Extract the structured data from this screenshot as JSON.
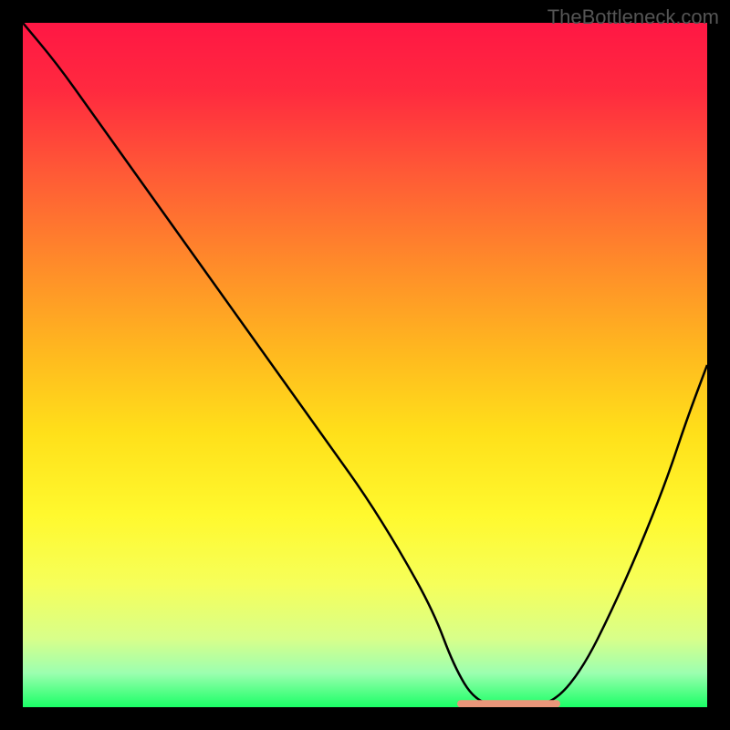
{
  "watermark": "TheBottleneck.com",
  "chart_data": {
    "type": "line",
    "title": "",
    "xlabel": "",
    "ylabel": "",
    "xlim": [
      0,
      100
    ],
    "ylim": [
      0,
      100
    ],
    "gradient_stops": [
      {
        "offset": 0,
        "color": "#ff1744"
      },
      {
        "offset": 10,
        "color": "#ff2a3f"
      },
      {
        "offset": 22,
        "color": "#ff5a36"
      },
      {
        "offset": 35,
        "color": "#ff8a2a"
      },
      {
        "offset": 48,
        "color": "#ffb81f"
      },
      {
        "offset": 60,
        "color": "#ffe01a"
      },
      {
        "offset": 72,
        "color": "#fff92e"
      },
      {
        "offset": 82,
        "color": "#f6ff5a"
      },
      {
        "offset": 90,
        "color": "#d8ff8a"
      },
      {
        "offset": 95,
        "color": "#9cffb0"
      },
      {
        "offset": 100,
        "color": "#1aff66"
      }
    ],
    "series": [
      {
        "name": "bottleneck-curve",
        "color": "#000000",
        "x": [
          0,
          5,
          10,
          15,
          20,
          25,
          30,
          35,
          40,
          45,
          50,
          55,
          60,
          63,
          66,
          70,
          74,
          78,
          82,
          86,
          90,
          94,
          97,
          100
        ],
        "y": [
          100,
          94,
          87,
          80,
          73,
          66,
          59,
          52,
          45,
          38,
          31,
          23,
          14,
          6,
          1,
          0,
          0,
          1,
          6,
          14,
          23,
          33,
          42,
          50
        ]
      }
    ],
    "optimal_zone": {
      "x_start": 64,
      "x_end": 78,
      "y": 0.5,
      "color": "#e9967a",
      "thickness": 8
    }
  }
}
